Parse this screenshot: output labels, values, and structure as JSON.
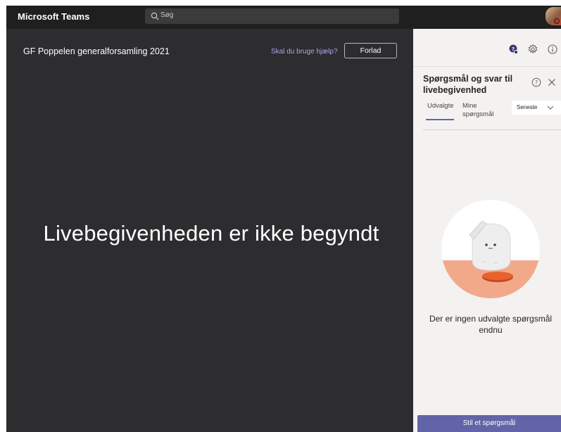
{
  "app": {
    "title": "Microsoft Teams"
  },
  "search": {
    "placeholder": "Søg"
  },
  "meeting": {
    "title": "GF Poppelen generalforsamling 2021",
    "help_link": "Skal du bruge hjælp?",
    "leave_label": "Forlad",
    "status_message": "Livebegivenheden er ikke begyndt"
  },
  "panel": {
    "icons": [
      "qna-chat-icon",
      "gear-icon",
      "info-icon"
    ],
    "heading": "Spørgsmål og svar til livebegivenhed",
    "tabs": [
      {
        "label": "Udvalgte",
        "selected": true
      },
      {
        "label": "Mine spørgsmål",
        "selected": false
      }
    ],
    "sort": {
      "selected": "Seneste"
    },
    "empty_message": "Der er ingen udvalgte spørgsmål endnu",
    "ask_button": "Stil et spørgsmål"
  },
  "colors": {
    "topbar": "#1f1f1f",
    "stage": "#2d2c2f",
    "panel": "#f3f2f1",
    "accent": "#6264a7",
    "link": "#a9a8f0"
  }
}
